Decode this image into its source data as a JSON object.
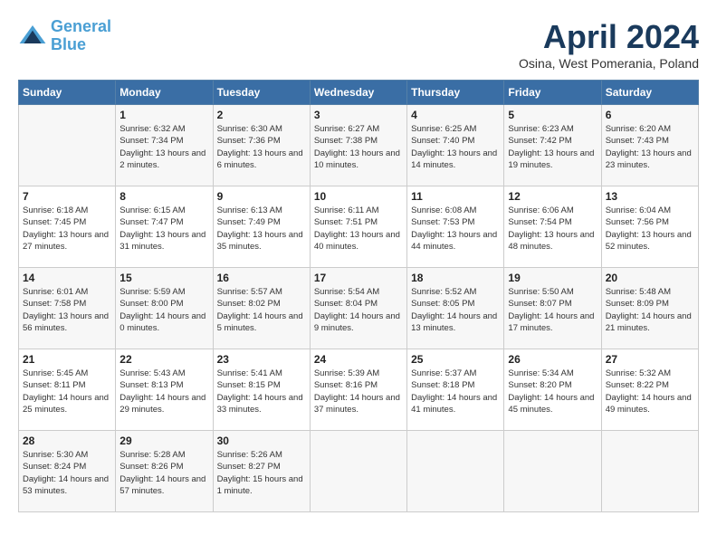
{
  "logo": {
    "line1": "General",
    "line2": "Blue"
  },
  "title": "April 2024",
  "location": "Osina, West Pomerania, Poland",
  "days_of_week": [
    "Sunday",
    "Monday",
    "Tuesday",
    "Wednesday",
    "Thursday",
    "Friday",
    "Saturday"
  ],
  "weeks": [
    [
      {
        "day": "",
        "sunrise": "",
        "sunset": "",
        "daylight": ""
      },
      {
        "day": "1",
        "sunrise": "Sunrise: 6:32 AM",
        "sunset": "Sunset: 7:34 PM",
        "daylight": "Daylight: 13 hours and 2 minutes."
      },
      {
        "day": "2",
        "sunrise": "Sunrise: 6:30 AM",
        "sunset": "Sunset: 7:36 PM",
        "daylight": "Daylight: 13 hours and 6 minutes."
      },
      {
        "day": "3",
        "sunrise": "Sunrise: 6:27 AM",
        "sunset": "Sunset: 7:38 PM",
        "daylight": "Daylight: 13 hours and 10 minutes."
      },
      {
        "day": "4",
        "sunrise": "Sunrise: 6:25 AM",
        "sunset": "Sunset: 7:40 PM",
        "daylight": "Daylight: 13 hours and 14 minutes."
      },
      {
        "day": "5",
        "sunrise": "Sunrise: 6:23 AM",
        "sunset": "Sunset: 7:42 PM",
        "daylight": "Daylight: 13 hours and 19 minutes."
      },
      {
        "day": "6",
        "sunrise": "Sunrise: 6:20 AM",
        "sunset": "Sunset: 7:43 PM",
        "daylight": "Daylight: 13 hours and 23 minutes."
      }
    ],
    [
      {
        "day": "7",
        "sunrise": "Sunrise: 6:18 AM",
        "sunset": "Sunset: 7:45 PM",
        "daylight": "Daylight: 13 hours and 27 minutes."
      },
      {
        "day": "8",
        "sunrise": "Sunrise: 6:15 AM",
        "sunset": "Sunset: 7:47 PM",
        "daylight": "Daylight: 13 hours and 31 minutes."
      },
      {
        "day": "9",
        "sunrise": "Sunrise: 6:13 AM",
        "sunset": "Sunset: 7:49 PM",
        "daylight": "Daylight: 13 hours and 35 minutes."
      },
      {
        "day": "10",
        "sunrise": "Sunrise: 6:11 AM",
        "sunset": "Sunset: 7:51 PM",
        "daylight": "Daylight: 13 hours and 40 minutes."
      },
      {
        "day": "11",
        "sunrise": "Sunrise: 6:08 AM",
        "sunset": "Sunset: 7:53 PM",
        "daylight": "Daylight: 13 hours and 44 minutes."
      },
      {
        "day": "12",
        "sunrise": "Sunrise: 6:06 AM",
        "sunset": "Sunset: 7:54 PM",
        "daylight": "Daylight: 13 hours and 48 minutes."
      },
      {
        "day": "13",
        "sunrise": "Sunrise: 6:04 AM",
        "sunset": "Sunset: 7:56 PM",
        "daylight": "Daylight: 13 hours and 52 minutes."
      }
    ],
    [
      {
        "day": "14",
        "sunrise": "Sunrise: 6:01 AM",
        "sunset": "Sunset: 7:58 PM",
        "daylight": "Daylight: 13 hours and 56 minutes."
      },
      {
        "day": "15",
        "sunrise": "Sunrise: 5:59 AM",
        "sunset": "Sunset: 8:00 PM",
        "daylight": "Daylight: 14 hours and 0 minutes."
      },
      {
        "day": "16",
        "sunrise": "Sunrise: 5:57 AM",
        "sunset": "Sunset: 8:02 PM",
        "daylight": "Daylight: 14 hours and 5 minutes."
      },
      {
        "day": "17",
        "sunrise": "Sunrise: 5:54 AM",
        "sunset": "Sunset: 8:04 PM",
        "daylight": "Daylight: 14 hours and 9 minutes."
      },
      {
        "day": "18",
        "sunrise": "Sunrise: 5:52 AM",
        "sunset": "Sunset: 8:05 PM",
        "daylight": "Daylight: 14 hours and 13 minutes."
      },
      {
        "day": "19",
        "sunrise": "Sunrise: 5:50 AM",
        "sunset": "Sunset: 8:07 PM",
        "daylight": "Daylight: 14 hours and 17 minutes."
      },
      {
        "day": "20",
        "sunrise": "Sunrise: 5:48 AM",
        "sunset": "Sunset: 8:09 PM",
        "daylight": "Daylight: 14 hours and 21 minutes."
      }
    ],
    [
      {
        "day": "21",
        "sunrise": "Sunrise: 5:45 AM",
        "sunset": "Sunset: 8:11 PM",
        "daylight": "Daylight: 14 hours and 25 minutes."
      },
      {
        "day": "22",
        "sunrise": "Sunrise: 5:43 AM",
        "sunset": "Sunset: 8:13 PM",
        "daylight": "Daylight: 14 hours and 29 minutes."
      },
      {
        "day": "23",
        "sunrise": "Sunrise: 5:41 AM",
        "sunset": "Sunset: 8:15 PM",
        "daylight": "Daylight: 14 hours and 33 minutes."
      },
      {
        "day": "24",
        "sunrise": "Sunrise: 5:39 AM",
        "sunset": "Sunset: 8:16 PM",
        "daylight": "Daylight: 14 hours and 37 minutes."
      },
      {
        "day": "25",
        "sunrise": "Sunrise: 5:37 AM",
        "sunset": "Sunset: 8:18 PM",
        "daylight": "Daylight: 14 hours and 41 minutes."
      },
      {
        "day": "26",
        "sunrise": "Sunrise: 5:34 AM",
        "sunset": "Sunset: 8:20 PM",
        "daylight": "Daylight: 14 hours and 45 minutes."
      },
      {
        "day": "27",
        "sunrise": "Sunrise: 5:32 AM",
        "sunset": "Sunset: 8:22 PM",
        "daylight": "Daylight: 14 hours and 49 minutes."
      }
    ],
    [
      {
        "day": "28",
        "sunrise": "Sunrise: 5:30 AM",
        "sunset": "Sunset: 8:24 PM",
        "daylight": "Daylight: 14 hours and 53 minutes."
      },
      {
        "day": "29",
        "sunrise": "Sunrise: 5:28 AM",
        "sunset": "Sunset: 8:26 PM",
        "daylight": "Daylight: 14 hours and 57 minutes."
      },
      {
        "day": "30",
        "sunrise": "Sunrise: 5:26 AM",
        "sunset": "Sunset: 8:27 PM",
        "daylight": "Daylight: 15 hours and 1 minute."
      },
      {
        "day": "",
        "sunrise": "",
        "sunset": "",
        "daylight": ""
      },
      {
        "day": "",
        "sunrise": "",
        "sunset": "",
        "daylight": ""
      },
      {
        "day": "",
        "sunrise": "",
        "sunset": "",
        "daylight": ""
      },
      {
        "day": "",
        "sunrise": "",
        "sunset": "",
        "daylight": ""
      }
    ]
  ]
}
